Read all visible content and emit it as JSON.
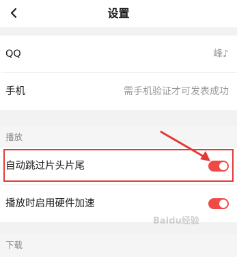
{
  "header": {
    "title": "设置",
    "back_icon": "chevron-left-icon"
  },
  "account": {
    "rows": [
      {
        "label": "QQ",
        "value": "峰♪"
      },
      {
        "label": "手机",
        "value": "需手机验证才可发表成功"
      }
    ]
  },
  "playback": {
    "section_label": "播放",
    "rows": [
      {
        "label": "自动跳过片头片尾",
        "toggle_on": true
      },
      {
        "label": "播放时启用硬件加速",
        "toggle_on": true
      }
    ]
  },
  "download": {
    "section_label": "下载"
  },
  "watermark": "Baidu经验",
  "colors": {
    "accent": "#f04a46",
    "annotation": "#e53935",
    "background": "#f2f2f2"
  }
}
